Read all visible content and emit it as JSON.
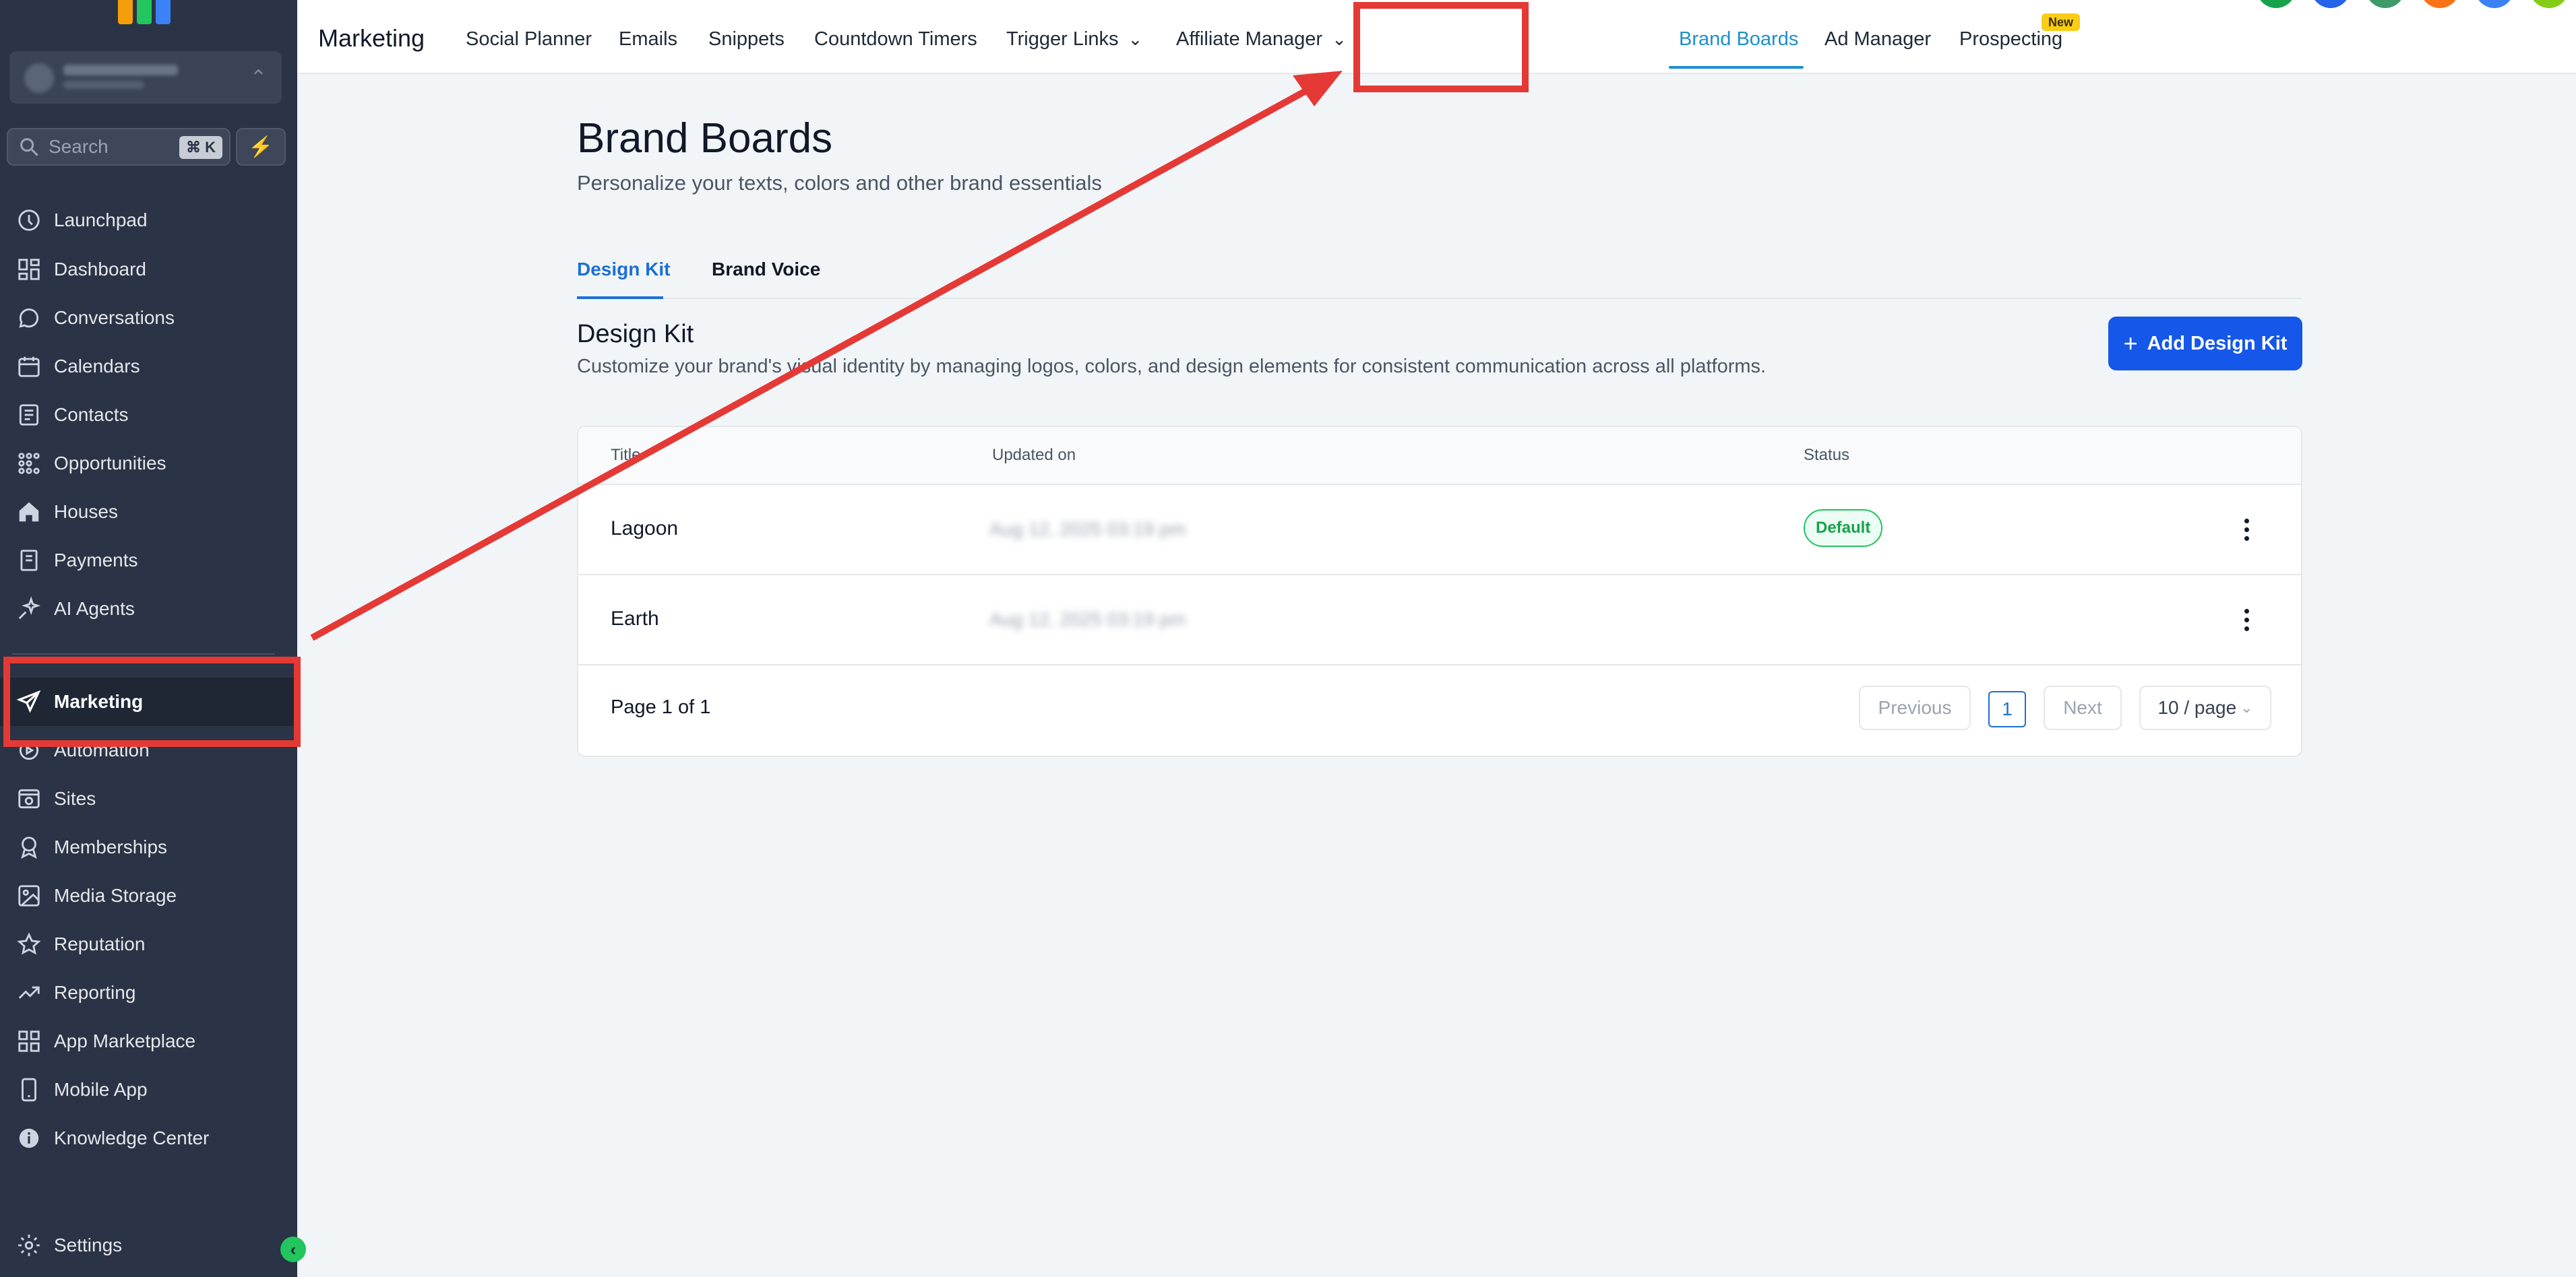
{
  "sidebar": {
    "search_placeholder": "Search",
    "search_shortcut": "⌘ K",
    "items": [
      {
        "label": "Launchpad",
        "icon": "launchpad-icon"
      },
      {
        "label": "Dashboard",
        "icon": "dashboard-icon"
      },
      {
        "label": "Conversations",
        "icon": "chat-bubble-icon"
      },
      {
        "label": "Calendars",
        "icon": "calendar-icon"
      },
      {
        "label": "Contacts",
        "icon": "contacts-icon"
      },
      {
        "label": "Opportunities",
        "icon": "opportunities-icon"
      },
      {
        "label": "Houses",
        "icon": "house-icon"
      },
      {
        "label": "Payments",
        "icon": "payments-icon"
      },
      {
        "label": "AI Agents",
        "icon": "sparkle-icon"
      },
      {
        "label": "Marketing",
        "icon": "send-icon",
        "active": true
      },
      {
        "label": "Automation",
        "icon": "automation-icon"
      },
      {
        "label": "Sites",
        "icon": "sites-icon"
      },
      {
        "label": "Memberships",
        "icon": "badge-icon"
      },
      {
        "label": "Media Storage",
        "icon": "image-icon"
      },
      {
        "label": "Reputation",
        "icon": "star-icon"
      },
      {
        "label": "Reporting",
        "icon": "trend-icon"
      },
      {
        "label": "App Marketplace",
        "icon": "grid-icon"
      },
      {
        "label": "Mobile App",
        "icon": "phone-icon"
      },
      {
        "label": "Knowledge Center",
        "icon": "info-icon"
      }
    ],
    "settings_label": "Settings"
  },
  "topbar": {
    "title": "Marketing",
    "nav": [
      {
        "label": "Social Planner"
      },
      {
        "label": "Emails"
      },
      {
        "label": "Snippets"
      },
      {
        "label": "Countdown Timers"
      },
      {
        "label": "Trigger Links",
        "dropdown": true
      },
      {
        "label": "Affiliate Manager",
        "dropdown": true
      },
      {
        "label": "Brand Boards",
        "active": true
      },
      {
        "label": "Ad Manager"
      },
      {
        "label": "Prospecting",
        "badge": "New"
      }
    ]
  },
  "main": {
    "title": "Brand Boards",
    "subtitle": "Personalize your texts, colors and other brand essentials",
    "tabs": [
      {
        "label": "Design Kit",
        "active": true
      },
      {
        "label": "Brand Voice"
      }
    ],
    "section": {
      "title": "Design Kit",
      "description": "Customize your brand's visual identity by managing logos, colors, and design elements for consistent communication across all platforms.",
      "add_button": "Add Design Kit"
    },
    "table": {
      "columns": [
        "Title",
        "Updated on",
        "Status"
      ],
      "rows": [
        {
          "title": "Lagoon",
          "updated": "Aug 12, 2025 03:19 pm",
          "status": "Default"
        },
        {
          "title": "Earth",
          "updated": "Aug 12, 2025 03:19 pm",
          "status": ""
        }
      ],
      "pagination": {
        "info": "Page 1 of 1",
        "previous": "Previous",
        "current_page": "1",
        "next": "Next",
        "page_size": "10 / page"
      }
    }
  },
  "colors": {
    "sidebar_bg": "#2a3446",
    "accent_blue": "#1557e8",
    "active_tab": "#1d8fcf",
    "annotation_red": "#e53935",
    "status_green": "#22c55e"
  }
}
